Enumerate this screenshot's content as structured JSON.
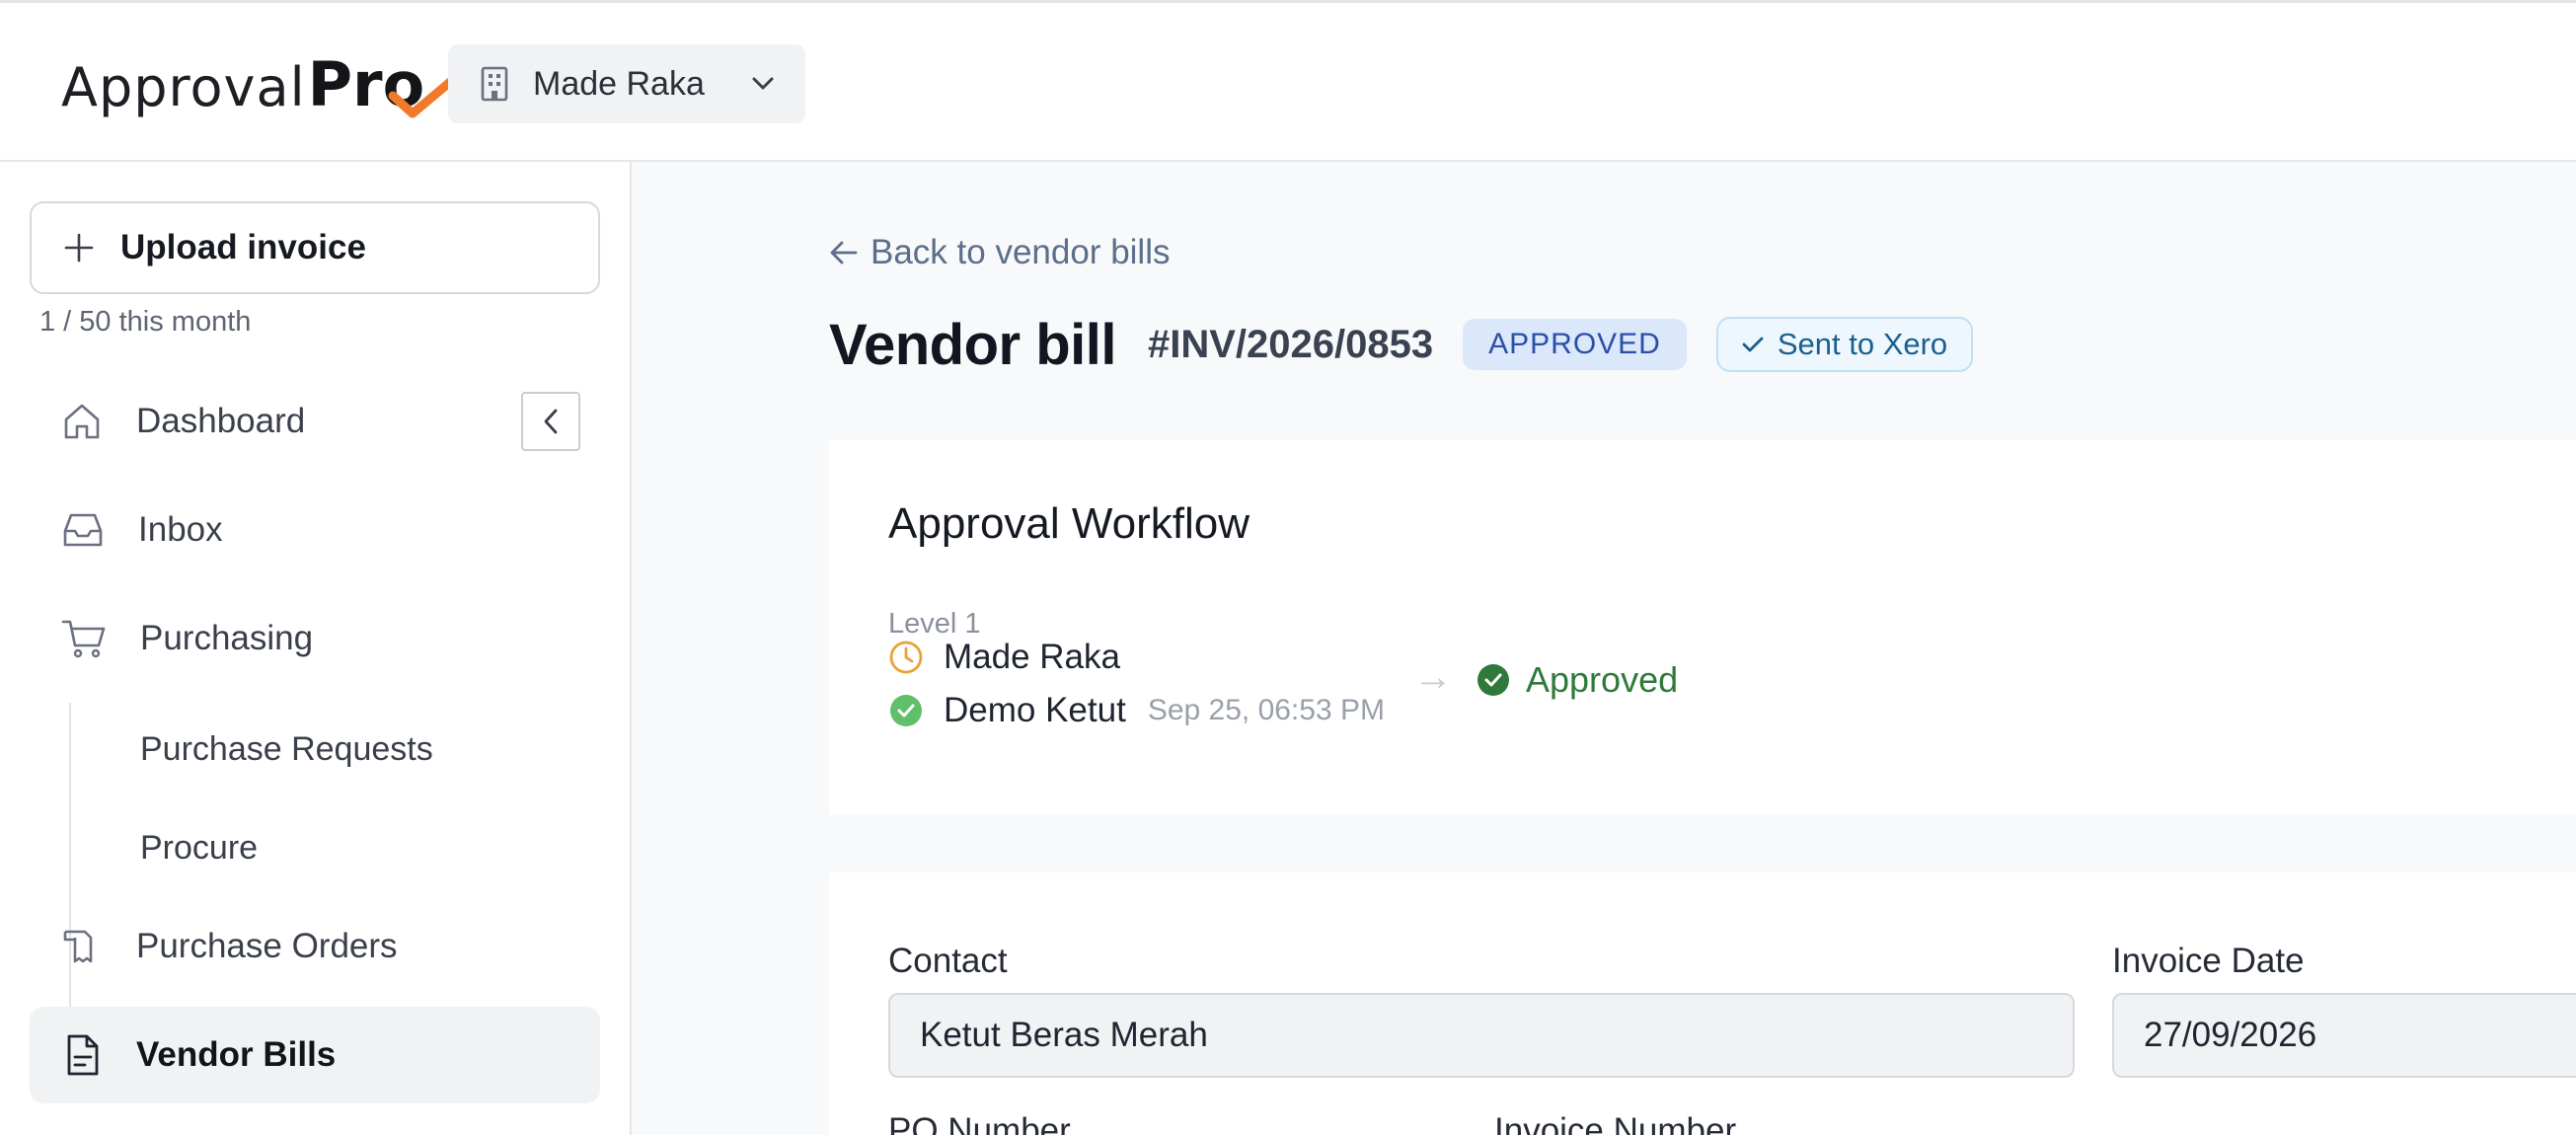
{
  "app": {
    "logo_prefix": "Approval",
    "logo_suffix": "Pro",
    "org_name": "Made Raka"
  },
  "sidebar": {
    "upload_label": "Upload invoice",
    "quota_text": "1 / 50 this month",
    "items": [
      {
        "label": "Dashboard",
        "icon": "home-icon"
      },
      {
        "label": "Inbox",
        "icon": "inbox-icon"
      },
      {
        "label": "Purchasing",
        "icon": "cart-icon"
      },
      {
        "label": "Purchase Orders",
        "icon": "receipt-icon"
      },
      {
        "label": "Vendor Bills",
        "icon": "file-icon",
        "active": true
      }
    ],
    "sub_items": [
      "Purchase Requests",
      "Procure"
    ]
  },
  "main": {
    "back_label": "Back to vendor bills",
    "title": "Vendor bill",
    "invoice_number": "#INV/2026/0853",
    "status_badge": "APPROVED",
    "xero_badge": "Sent to Xero",
    "workflow": {
      "title": "Approval Workflow",
      "level": "Level 1",
      "approvers": [
        {
          "name": "Made Raka",
          "status": "pending",
          "time": ""
        },
        {
          "name": "Demo Ketut",
          "status": "approved",
          "time": "Sep 25, 06:53 PM"
        }
      ],
      "result": "Approved"
    },
    "form": {
      "contact_label": "Contact",
      "contact_value": "Ketut Beras Merah",
      "invoice_date_label": "Invoice Date",
      "invoice_date_value": "27/09/2026",
      "po_number_label": "PO Number",
      "invoice_number_label": "Invoice Number"
    }
  },
  "colors": {
    "accent_orange": "#f07a2a",
    "approved_green": "#2f7a3a",
    "badge_blue": "#2c4fa6"
  }
}
